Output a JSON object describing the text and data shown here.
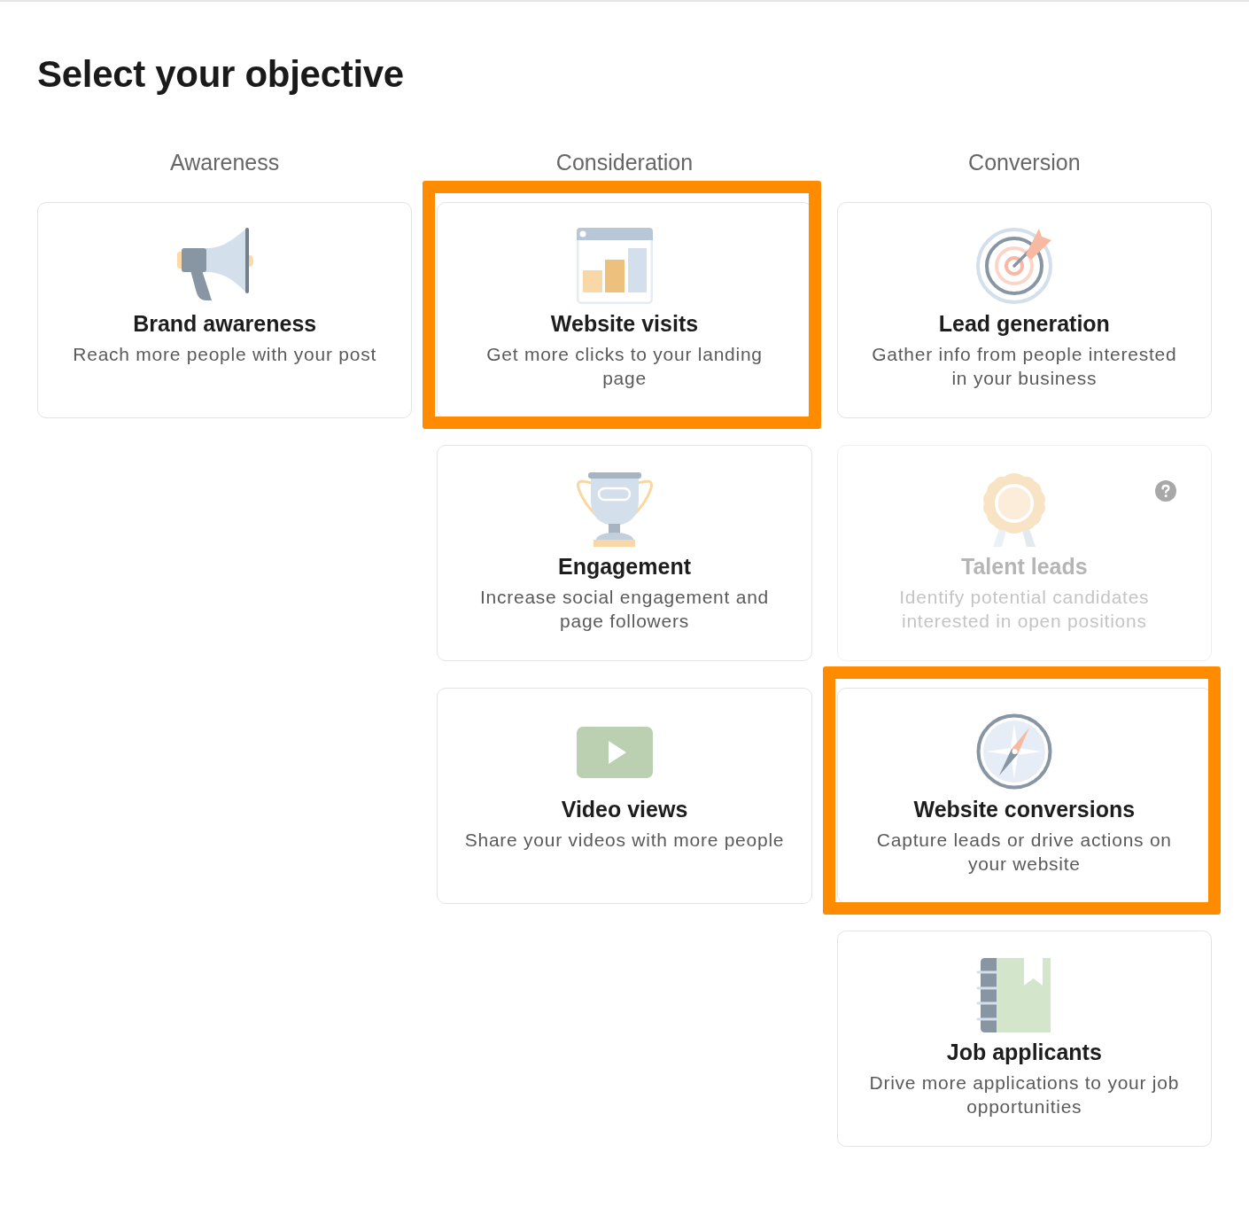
{
  "page": {
    "title": "Select your objective"
  },
  "columns": [
    {
      "heading": "Awareness",
      "cards": [
        {
          "kind": "megaphone",
          "title": "Brand awareness",
          "description": "Reach more people with your post",
          "disabled": false,
          "highlighted": false,
          "help_icon": false
        }
      ]
    },
    {
      "heading": "Consideration",
      "cards": [
        {
          "kind": "bar_chart",
          "title": "Website visits",
          "description": "Get more clicks to your landing page",
          "disabled": false,
          "highlighted": true,
          "help_icon": false
        },
        {
          "kind": "trophy",
          "title": "Engagement",
          "description": "Increase social engagement and page followers",
          "disabled": false,
          "highlighted": false,
          "help_icon": false
        },
        {
          "kind": "video",
          "title": "Video views",
          "description": "Share your videos with more people",
          "disabled": false,
          "highlighted": false,
          "help_icon": false
        }
      ]
    },
    {
      "heading": "Conversion",
      "cards": [
        {
          "kind": "target",
          "title": "Lead generation",
          "description": "Gather info from people interested in your business",
          "disabled": false,
          "highlighted": false,
          "help_icon": false
        },
        {
          "kind": "rosette",
          "title": "Talent leads",
          "description": "Identify potential candidates interested in open positions",
          "disabled": true,
          "highlighted": false,
          "help_icon": true
        },
        {
          "kind": "compass",
          "title": "Website conversions",
          "description": "Capture leads or drive actions on your website",
          "disabled": false,
          "highlighted": true,
          "help_icon": false
        },
        {
          "kind": "notebook",
          "title": "Job applicants",
          "description": "Drive more applications to your job opportunities",
          "disabled": false,
          "highlighted": false,
          "help_icon": false
        }
      ]
    }
  ]
}
